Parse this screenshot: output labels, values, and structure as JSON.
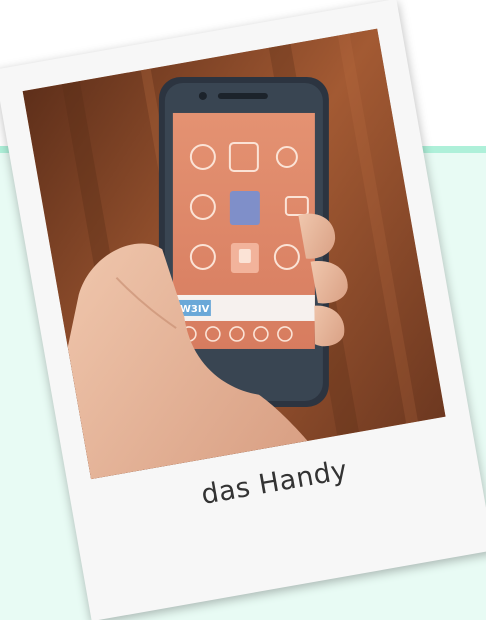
{
  "polaroid": {
    "caption": "das Handy"
  },
  "photo": {
    "subject": "hand-holding-smartphone",
    "screen_badge_text": "W3IV"
  },
  "colors": {
    "mint_panel": "#e8fbf4",
    "mint_strip": "#aef0d9",
    "frame": "#f7f7f7",
    "wood": "#8a4a2a"
  }
}
